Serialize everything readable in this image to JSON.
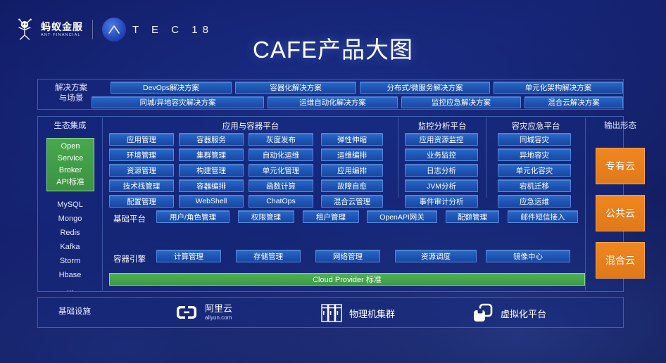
{
  "brand": {
    "ant_cn": "蚂蚁金服",
    "ant_en": "ANT FINANCIAL",
    "atec": "ATEC 18",
    "atec_label": "T E C  18",
    "logo_icon": "ant-financial-logo-icon",
    "atec_icon": "atec-circle-icon"
  },
  "title": "CAFE产品大图",
  "solutions": {
    "label": "解决方案\n与场景",
    "label_line1": "解决方案",
    "label_line2": "与场景",
    "row1": [
      "DevOps解决方案",
      "容器化解决方案",
      "分布式/微服务解决方案",
      "单元化架构解决方案"
    ],
    "row2": [
      "同城/异地容灾解决方案",
      "运维自动化解决方案",
      "监控应急解决方案",
      "混合云解决方案"
    ]
  },
  "ecosystem": {
    "label": "生态集成",
    "highlight": [
      "Open",
      "Service",
      "Broker",
      "API标准"
    ],
    "items": [
      "MySQL",
      "Mongo",
      "Redis",
      "Kafka",
      "Storm",
      "Hbase",
      "..."
    ]
  },
  "platforms": {
    "app_container": {
      "title": "应用与容器平台",
      "columns": [
        [
          "应用管理",
          "环境管理",
          "资源管理",
          "技术栈管理",
          "配置管理"
        ],
        [
          "容器服务",
          "集群管理",
          "构建管理",
          "容器编排",
          "WebShell"
        ],
        [
          "灰度发布",
          "自动化运维",
          "单元化管理",
          "函数计算",
          "ChatOps"
        ],
        [
          "弹性伸缩",
          "运维编排",
          "应用编排",
          "故障自愈",
          "混合云管理"
        ]
      ]
    },
    "monitoring": {
      "title": "监控分析平台",
      "items": [
        "应用资源监控",
        "业务监控",
        "日志分析",
        "JVM分析",
        "事件审计分析"
      ]
    },
    "disaster_recovery": {
      "title": "容灾应急平台",
      "items": [
        "同城容灾",
        "异地容灾",
        "单元化容灾",
        "宕机迁移",
        "应急运维"
      ]
    }
  },
  "base_platform": {
    "label": "基础平台",
    "items": [
      "用户/角色管理",
      "权限管理",
      "租户管理",
      "OpenAPI网关",
      "配额管理",
      "邮件短信接入"
    ]
  },
  "container_engine": {
    "label": "容器引擎",
    "items": [
      "计算管理",
      "存储管理",
      "网络管理",
      "资源调度",
      "镜像中心"
    ]
  },
  "cloud_provider_bar": "Cloud Provider 标准",
  "output": {
    "label": "输出形态",
    "items": [
      "专有云",
      "公共云",
      "混合云"
    ]
  },
  "infrastructure": {
    "label": "基础设施",
    "items": [
      {
        "name": "阿里云",
        "sub": "aliyun.com",
        "icon": "aliyun-logo-icon"
      },
      {
        "name": "物理机集群",
        "sub": "",
        "icon": "server-rack-icon"
      },
      {
        "name": "虚拟化平台",
        "sub": "",
        "icon": "virtualization-icon"
      }
    ]
  },
  "colors": {
    "background": "#121b5e",
    "chip_blue": "#2a69c8",
    "accent_green": "#47a84c",
    "accent_orange": "#f0861f",
    "panel_border": "#78a0eb"
  }
}
